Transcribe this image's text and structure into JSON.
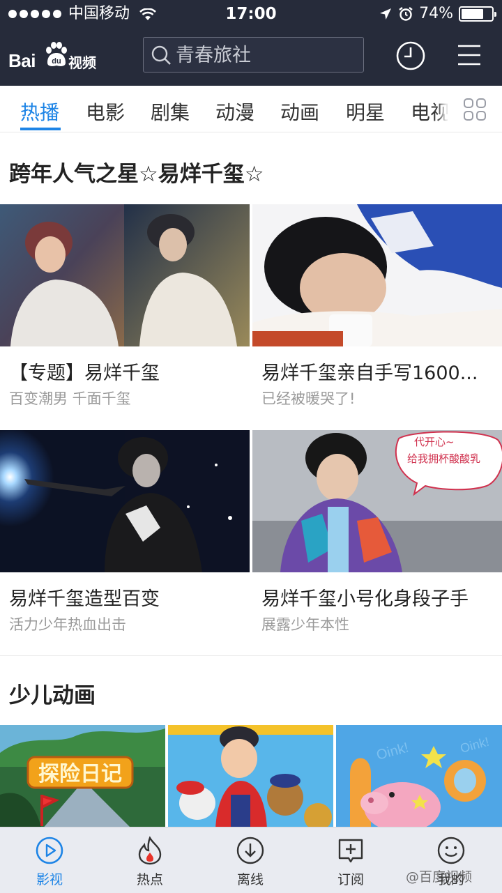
{
  "status_bar": {
    "carrier": "中国移动",
    "time": "17:00",
    "battery_percent": "74%",
    "battery_level": 0.74,
    "icons": [
      "signal-dots",
      "wifi-icon",
      "location-arrow-icon",
      "alarm-icon",
      "battery-icon"
    ]
  },
  "header": {
    "logo_text_bai": "Bai",
    "logo_text_du": "du",
    "logo_text_video": "视频",
    "search_placeholder": "青春旅社",
    "icons": [
      "search-icon",
      "history-clock-icon",
      "menu-icon"
    ]
  },
  "tabs": {
    "items": [
      "热播",
      "电影",
      "剧集",
      "动漫",
      "动画",
      "明星",
      "电视"
    ],
    "active_index": 0,
    "accent_color": "#1d84e6"
  },
  "section_star": {
    "title": "跨年人气之星☆易烊千玺☆",
    "cards": [
      {
        "title": "【专题】易烊千玺",
        "subtitle": "百变潮男 千面千玺"
      },
      {
        "title": "易烊千玺亲自手写1600...",
        "subtitle": "已经被暖哭了!"
      },
      {
        "title": "易烊千玺造型百变",
        "subtitle": "活力少年热血出击"
      },
      {
        "title": "易烊千玺小号化身段子手",
        "subtitle": "展露少年本性"
      }
    ],
    "image_captions": {
      "bubble_text_1": "代开心~",
      "bubble_text_2": "给我拥杯酸酸乳"
    }
  },
  "section_kids": {
    "title": "少儿动画",
    "poster_1_text": "探险日记",
    "poster_3_text_a": "Oink!",
    "poster_3_text_b": "Oink!"
  },
  "bottom_nav": {
    "items": [
      "影视",
      "热点",
      "离线",
      "订阅",
      "我的"
    ],
    "active_index": 0,
    "watermark": "@百度视频"
  },
  "colors": {
    "header_bg": "#262b3a",
    "accent": "#1d84e6",
    "subtext": "#999999"
  }
}
